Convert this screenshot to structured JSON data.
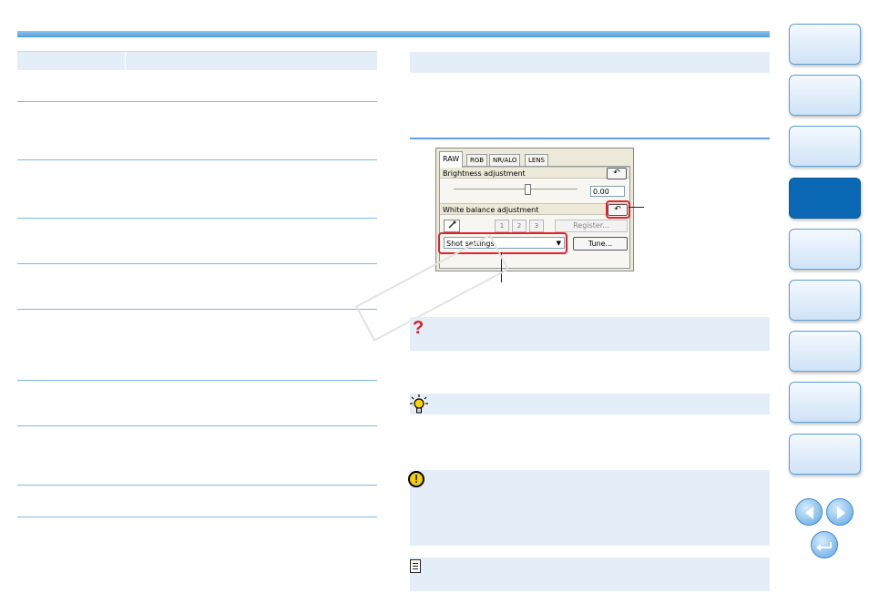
{
  "panel": {
    "tabs": [
      "RAW",
      "RGB",
      "NR/ALO",
      "LENS"
    ],
    "brightness_label": "Brightness adjustment",
    "brightness_value": "0.00",
    "white_balance_label": "White balance adjustment",
    "click_white_buttons": [
      "1",
      "2",
      "3"
    ],
    "register_label": "Register...",
    "wb_select_value": "Shot settings",
    "tune_label": "Tune...",
    "reset_symbol": "↶"
  },
  "icons": {
    "question": "?",
    "warning": "!"
  },
  "colors": {
    "accent_blue": "#4d9de0",
    "box_background": "#e4eef9",
    "highlight_red": "#e8202a",
    "active_nav": "#0a68b4"
  },
  "nav": {
    "active_index": 3,
    "tab_count": 9
  }
}
